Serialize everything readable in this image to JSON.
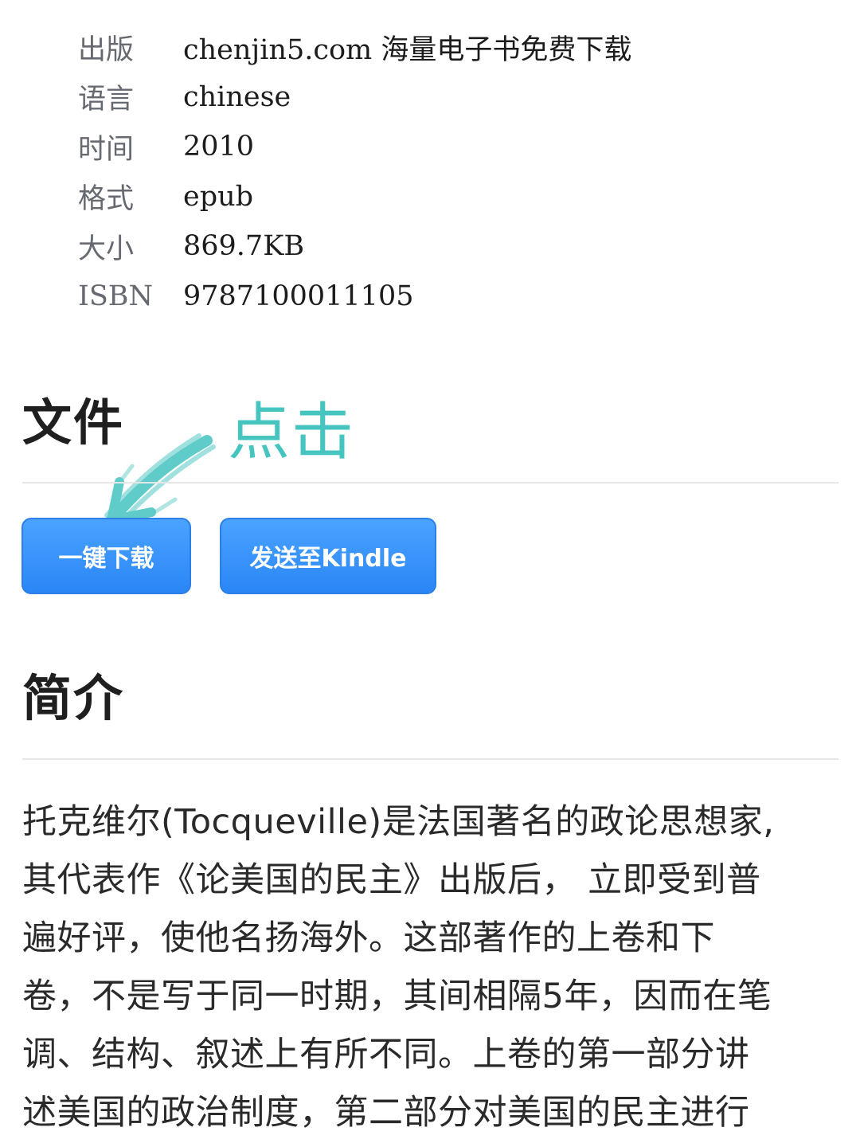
{
  "metadata": [
    {
      "label": "出版",
      "value": "chenjin5.com 海量电子书免费下载"
    },
    {
      "label": "语言",
      "value": "chinese"
    },
    {
      "label": "时间",
      "value": "2010"
    },
    {
      "label": "格式",
      "value": "epub"
    },
    {
      "label": "大小",
      "value": "869.7KB"
    },
    {
      "label": "ISBN",
      "value": "9787100011105"
    }
  ],
  "files_section": {
    "title": "文件",
    "download_label": "一键下载",
    "kindle_label": "发送至Kindle"
  },
  "annotation": {
    "text": "点击",
    "color": "#45c4c0"
  },
  "intro_section": {
    "title": "简介",
    "lines": [
      "托克维尔(Tocqueville)是法国著名的政论思想家,",
      "其代表作《论美国的民主》出版后， 立即受到普",
      "遍好评，使他名扬海外。这部著作的上卷和下",
      "卷，不是写于同一时期，其间相隔5年，因而在笔",
      "调、结构、叙述上有所不同。上卷的第一部分讲",
      "述美国的政治制度，第二部分对美国的民主进行"
    ]
  },
  "colors": {
    "button": "#2a86f5",
    "label": "#666a70"
  }
}
